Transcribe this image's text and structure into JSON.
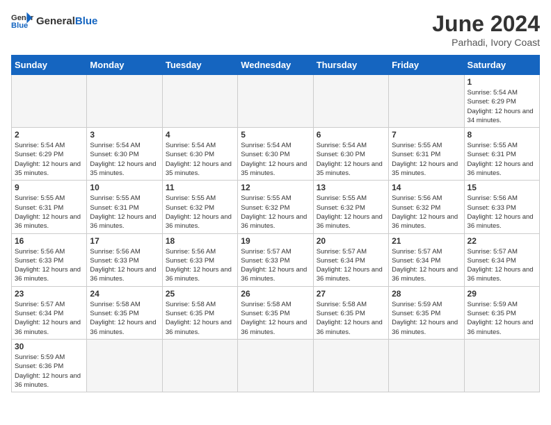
{
  "header": {
    "logo_general": "General",
    "logo_blue": "Blue",
    "month_title": "June 2024",
    "subtitle": "Parhadi, Ivory Coast"
  },
  "days_of_week": [
    "Sunday",
    "Monday",
    "Tuesday",
    "Wednesday",
    "Thursday",
    "Friday",
    "Saturday"
  ],
  "weeks": [
    [
      {
        "day": "",
        "info": ""
      },
      {
        "day": "",
        "info": ""
      },
      {
        "day": "",
        "info": ""
      },
      {
        "day": "",
        "info": ""
      },
      {
        "day": "",
        "info": ""
      },
      {
        "day": "",
        "info": ""
      },
      {
        "day": "1",
        "info": "Sunrise: 5:54 AM\nSunset: 6:29 PM\nDaylight: 12 hours and 34 minutes."
      }
    ],
    [
      {
        "day": "2",
        "info": "Sunrise: 5:54 AM\nSunset: 6:29 PM\nDaylight: 12 hours and 35 minutes."
      },
      {
        "day": "3",
        "info": "Sunrise: 5:54 AM\nSunset: 6:30 PM\nDaylight: 12 hours and 35 minutes."
      },
      {
        "day": "4",
        "info": "Sunrise: 5:54 AM\nSunset: 6:30 PM\nDaylight: 12 hours and 35 minutes."
      },
      {
        "day": "5",
        "info": "Sunrise: 5:54 AM\nSunset: 6:30 PM\nDaylight: 12 hours and 35 minutes."
      },
      {
        "day": "6",
        "info": "Sunrise: 5:54 AM\nSunset: 6:30 PM\nDaylight: 12 hours and 35 minutes."
      },
      {
        "day": "7",
        "info": "Sunrise: 5:55 AM\nSunset: 6:31 PM\nDaylight: 12 hours and 35 minutes."
      },
      {
        "day": "8",
        "info": "Sunrise: 5:55 AM\nSunset: 6:31 PM\nDaylight: 12 hours and 36 minutes."
      }
    ],
    [
      {
        "day": "9",
        "info": "Sunrise: 5:55 AM\nSunset: 6:31 PM\nDaylight: 12 hours and 36 minutes."
      },
      {
        "day": "10",
        "info": "Sunrise: 5:55 AM\nSunset: 6:31 PM\nDaylight: 12 hours and 36 minutes."
      },
      {
        "day": "11",
        "info": "Sunrise: 5:55 AM\nSunset: 6:32 PM\nDaylight: 12 hours and 36 minutes."
      },
      {
        "day": "12",
        "info": "Sunrise: 5:55 AM\nSunset: 6:32 PM\nDaylight: 12 hours and 36 minutes."
      },
      {
        "day": "13",
        "info": "Sunrise: 5:55 AM\nSunset: 6:32 PM\nDaylight: 12 hours and 36 minutes."
      },
      {
        "day": "14",
        "info": "Sunrise: 5:56 AM\nSunset: 6:32 PM\nDaylight: 12 hours and 36 minutes."
      },
      {
        "day": "15",
        "info": "Sunrise: 5:56 AM\nSunset: 6:33 PM\nDaylight: 12 hours and 36 minutes."
      }
    ],
    [
      {
        "day": "16",
        "info": "Sunrise: 5:56 AM\nSunset: 6:33 PM\nDaylight: 12 hours and 36 minutes."
      },
      {
        "day": "17",
        "info": "Sunrise: 5:56 AM\nSunset: 6:33 PM\nDaylight: 12 hours and 36 minutes."
      },
      {
        "day": "18",
        "info": "Sunrise: 5:56 AM\nSunset: 6:33 PM\nDaylight: 12 hours and 36 minutes."
      },
      {
        "day": "19",
        "info": "Sunrise: 5:57 AM\nSunset: 6:33 PM\nDaylight: 12 hours and 36 minutes."
      },
      {
        "day": "20",
        "info": "Sunrise: 5:57 AM\nSunset: 6:34 PM\nDaylight: 12 hours and 36 minutes."
      },
      {
        "day": "21",
        "info": "Sunrise: 5:57 AM\nSunset: 6:34 PM\nDaylight: 12 hours and 36 minutes."
      },
      {
        "day": "22",
        "info": "Sunrise: 5:57 AM\nSunset: 6:34 PM\nDaylight: 12 hours and 36 minutes."
      }
    ],
    [
      {
        "day": "23",
        "info": "Sunrise: 5:57 AM\nSunset: 6:34 PM\nDaylight: 12 hours and 36 minutes."
      },
      {
        "day": "24",
        "info": "Sunrise: 5:58 AM\nSunset: 6:35 PM\nDaylight: 12 hours and 36 minutes."
      },
      {
        "day": "25",
        "info": "Sunrise: 5:58 AM\nSunset: 6:35 PM\nDaylight: 12 hours and 36 minutes."
      },
      {
        "day": "26",
        "info": "Sunrise: 5:58 AM\nSunset: 6:35 PM\nDaylight: 12 hours and 36 minutes."
      },
      {
        "day": "27",
        "info": "Sunrise: 5:58 AM\nSunset: 6:35 PM\nDaylight: 12 hours and 36 minutes."
      },
      {
        "day": "28",
        "info": "Sunrise: 5:59 AM\nSunset: 6:35 PM\nDaylight: 12 hours and 36 minutes."
      },
      {
        "day": "29",
        "info": "Sunrise: 5:59 AM\nSunset: 6:35 PM\nDaylight: 12 hours and 36 minutes."
      }
    ],
    [
      {
        "day": "30",
        "info": "Sunrise: 5:59 AM\nSunset: 6:36 PM\nDaylight: 12 hours and 36 minutes."
      },
      {
        "day": "",
        "info": ""
      },
      {
        "day": "",
        "info": ""
      },
      {
        "day": "",
        "info": ""
      },
      {
        "day": "",
        "info": ""
      },
      {
        "day": "",
        "info": ""
      },
      {
        "day": "",
        "info": ""
      }
    ]
  ]
}
